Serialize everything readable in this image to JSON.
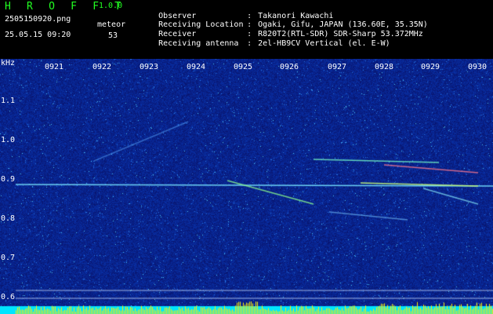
{
  "header": {
    "app_name": "H R O F F T",
    "version": "1.0.0",
    "filename": "2505150920.png",
    "datetime": "25.05.15 09:20",
    "meteor_label": "meteor",
    "meteor_count": "53"
  },
  "info": [
    {
      "key": "Observer",
      "sep": ":",
      "value": "Takanori Kawachi"
    },
    {
      "key": "Receiving Location",
      "sep": ":",
      "value": "Ogaki, Gifu, JAPAN (136.60E, 35.35N)"
    },
    {
      "key": "Receiver",
      "sep": ":",
      "value": "R820T2(RTL-SDR) SDR-Sharp 53.372MHz"
    },
    {
      "key": "Receiving antenna",
      "sep": ":",
      "value": "2el-HB9CV Vertical (el. E-W)"
    }
  ],
  "axes": {
    "y_unit": "kHz",
    "y_ticks": [
      "1.1",
      "1.0",
      "0.9",
      "0.8",
      "0.7",
      "0.6"
    ],
    "x_ticks": [
      "0921",
      "0922",
      "0923",
      "0924",
      "0925",
      "0926",
      "0927",
      "0928",
      "0929",
      "0930"
    ]
  },
  "colors": {
    "background": "#000000",
    "spectrogram_base": "#0a1c8c",
    "logo": "#22ff22",
    "noise_bar": "#ffee00",
    "noise_base": "#00e5ff"
  }
}
